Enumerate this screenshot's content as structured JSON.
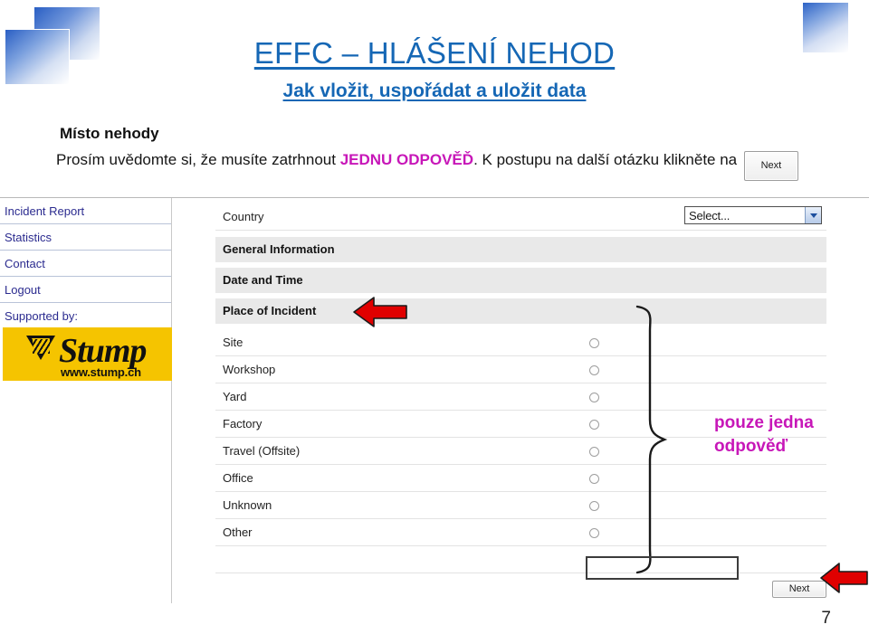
{
  "slide": {
    "title_main": "EFFC – HLÁŠENÍ NEHOD",
    "title_sub": "Jak vložit, uspořádat a uložit data",
    "page_number": "7",
    "accent_blue": "#1567b5",
    "accent_magenta": "#c717b8",
    "arrow_red": "#e00000"
  },
  "instructions": {
    "heading": "Místo nehody",
    "text_before": "Prosím uvědomte si, že musíte zatrhnout ",
    "emphasis": "JEDNU ODPOVĚĎ",
    "text_after": ". K postupu na další otázku klikněte na ",
    "inline_button": "Next"
  },
  "app": {
    "sidebar": {
      "links": [
        {
          "label": "Incident Report"
        },
        {
          "label": "Statistics"
        },
        {
          "label": "Contact"
        },
        {
          "label": "Logout"
        }
      ],
      "supported_by_label": "Supported by:",
      "sponsor": {
        "name": "Stump",
        "url": "www.stump.ch",
        "background": "#f5c400"
      }
    },
    "form": {
      "country_row": {
        "label": "Country",
        "select_value": "Select...",
        "select_icon": "chevron-down-icon"
      },
      "sections": [
        {
          "label": "General Information"
        },
        {
          "label": "Date and Time"
        },
        {
          "label": "Place of Incident"
        }
      ],
      "options": [
        {
          "label": "Site"
        },
        {
          "label": "Workshop"
        },
        {
          "label": "Yard"
        },
        {
          "label": "Factory"
        },
        {
          "label": "Travel (Offsite)"
        },
        {
          "label": "Office"
        },
        {
          "label": "Unknown"
        },
        {
          "label": "Other"
        }
      ],
      "next_button": "Next"
    }
  },
  "annotations": {
    "callout_text_line1": "pouze jedna",
    "callout_text_line2": "odpověď",
    "arrow_place_of_incident": "left-arrow-icon",
    "arrow_next_button": "left-arrow-icon",
    "brace": "curly-brace-icon",
    "highlight_box": "highlight-rectangle"
  }
}
